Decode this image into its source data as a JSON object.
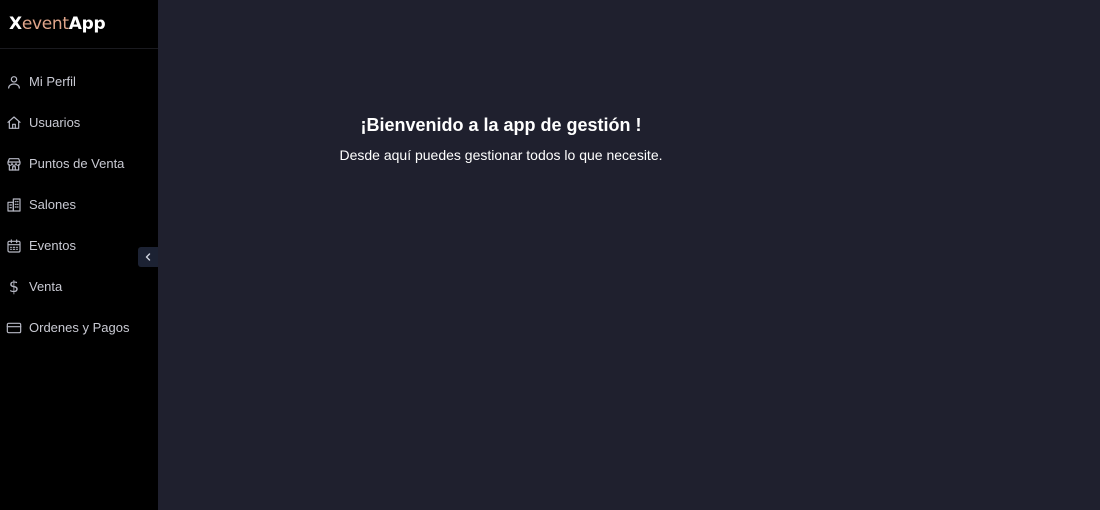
{
  "brand": {
    "part1": "X",
    "part2": "event",
    "part3": "App"
  },
  "sidebar": {
    "items": [
      {
        "label": "Mi Perfil",
        "icon": "user-icon"
      },
      {
        "label": "Usuarios",
        "icon": "home-icon"
      },
      {
        "label": "Puntos de Venta",
        "icon": "store-icon"
      },
      {
        "label": "Salones",
        "icon": "building-icon"
      },
      {
        "label": "Eventos",
        "icon": "calendar-icon"
      },
      {
        "label": "Venta",
        "icon": "dollar-icon"
      },
      {
        "label": "Ordenes y Pagos",
        "icon": "credit-card-icon"
      }
    ],
    "collapse_icon": "chevron-left-icon"
  },
  "main": {
    "title": "¡Bienvenido a la app de gestión !",
    "subtitle": "Desde aquí puedes gestionar todos lo que necesite."
  },
  "colors": {
    "sidebar_bg": "#000000",
    "main_bg": "#1f202e",
    "brand_accent": "#e0a58a"
  }
}
